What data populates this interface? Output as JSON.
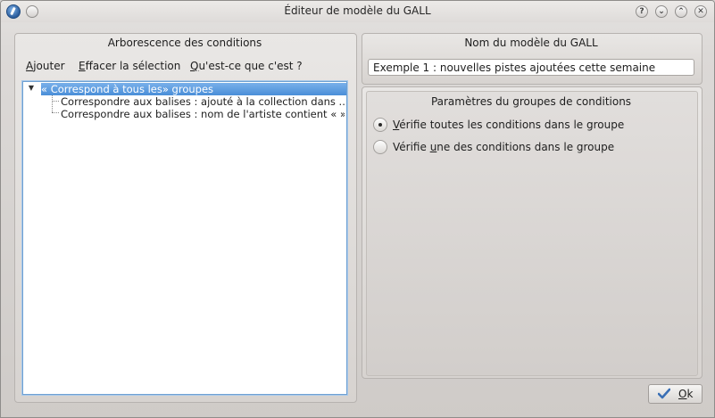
{
  "window": {
    "title": "Éditeur de modèle du GALL",
    "buttons": {
      "help": "?",
      "shade": "⌄",
      "maximize": "⌃",
      "close": "✕"
    }
  },
  "left_panel": {
    "heading": "Arborescence des conditions",
    "actions": {
      "add_mnemonic": "A",
      "add_rest": "jouter",
      "clear_mnemonic": "E",
      "clear_rest": "ffacer la sélection",
      "whatsthis_mnemonic": "Q",
      "whatsthis_rest": "u'est-ce que c'est ?"
    },
    "tree": {
      "root": "« Correspond à tous les» groupes",
      "children": [
        "Correspondre aux balises :  ajouté à la collection dans ...",
        "Correspondre aux balises :  nom de l'artiste contient « »"
      ]
    }
  },
  "right_panel": {
    "name_heading": "Nom du modèle du GALL",
    "name_value": "Exemple 1 : nouvelles pistes ajoutées cette semaine",
    "params_heading": "Paramètres du groupes de conditions",
    "options": [
      {
        "pre": "",
        "mnemonic": "V",
        "rest": "érifie toutes les conditions dans le groupe",
        "selected": true
      },
      {
        "pre": "Vérifie ",
        "mnemonic": "u",
        "rest": "ne des conditions dans le groupe",
        "selected": false
      }
    ]
  },
  "ok_button": {
    "mnemonic": "O",
    "rest": "k"
  },
  "colors": {
    "selection": "#4a8ed8",
    "focus": "#6fa0d2",
    "ok_check": "#3a6fb5"
  }
}
